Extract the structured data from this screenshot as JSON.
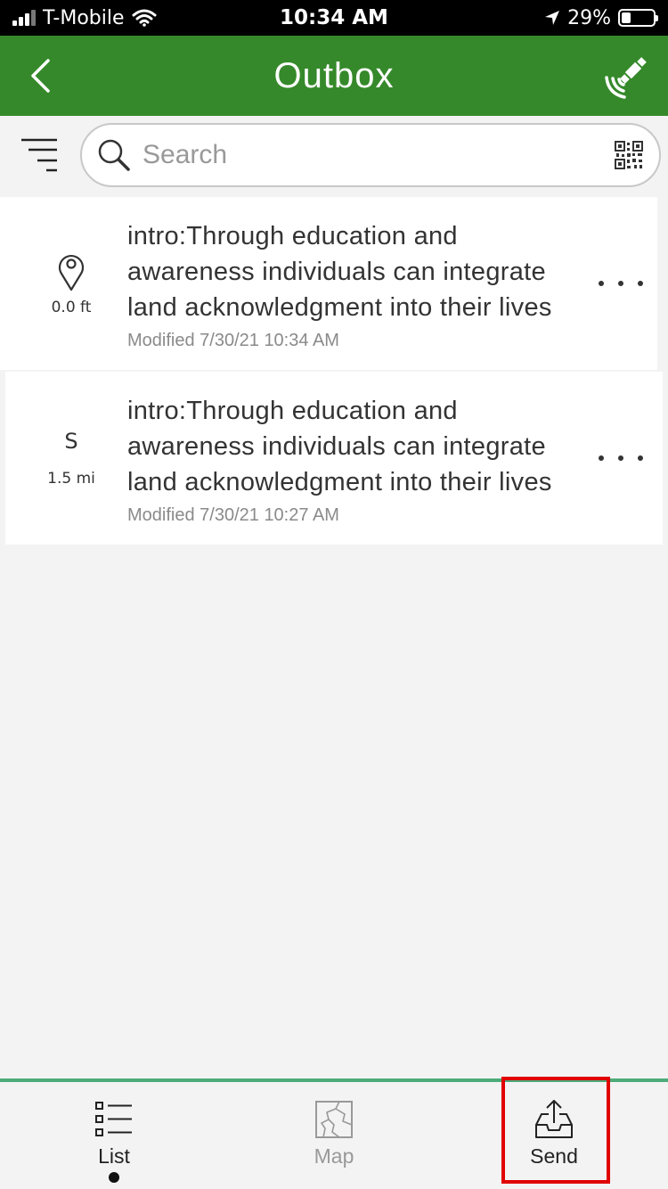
{
  "status_bar": {
    "carrier": "T-Mobile",
    "time": "10:34 AM",
    "battery": "29%"
  },
  "nav": {
    "title": "Outbox"
  },
  "search": {
    "placeholder": "Search"
  },
  "items": [
    {
      "title": "intro:Through education and awareness individuals can integrate land acknowledgment into their lives",
      "modified": "Modified 7/30/21 10:34 AM",
      "distance": "0.0 ft",
      "direction": ""
    },
    {
      "title": "intro:Through education and awareness individuals can integrate land acknowledgment into their lives",
      "modified": "Modified 7/30/21 10:27 AM",
      "distance": "1.5 mi",
      "direction": "S"
    }
  ],
  "tabs": {
    "list": "List",
    "map": "Map",
    "send": "Send"
  },
  "colors": {
    "header": "#35892a",
    "tab_border": "#4dab7a",
    "highlight": "#e00000"
  },
  "icons": [
    "back-chevron-icon",
    "gps-satellite-icon",
    "filter-icon",
    "search-icon",
    "qr-code-icon",
    "location-pin-icon",
    "more-icon",
    "list-icon",
    "map-icon",
    "send-outbox-icon"
  ]
}
